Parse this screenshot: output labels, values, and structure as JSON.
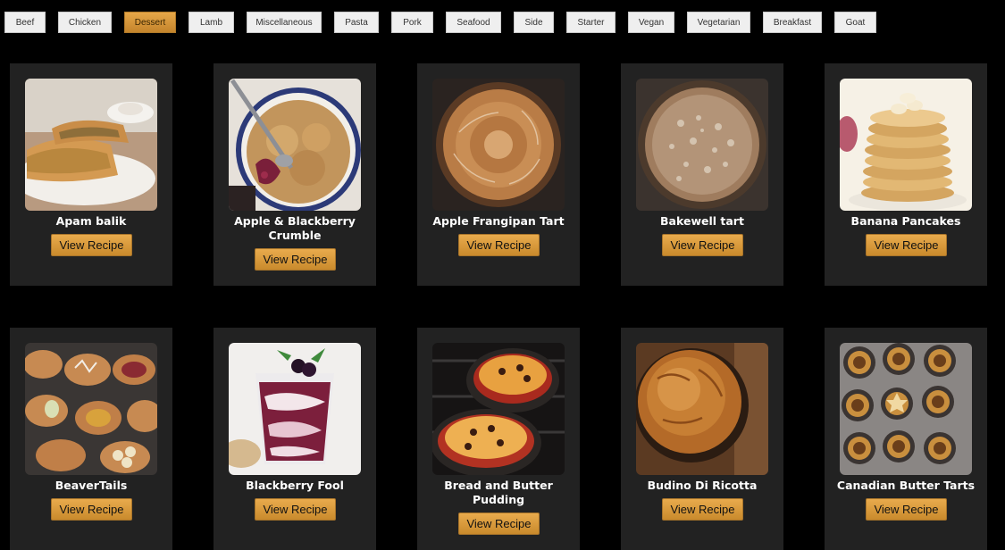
{
  "categories": [
    "Beef",
    "Chicken",
    "Dessert",
    "Lamb",
    "Miscellaneous",
    "Pasta",
    "Pork",
    "Seafood",
    "Side",
    "Starter",
    "Vegan",
    "Vegetarian",
    "Breakfast",
    "Goat"
  ],
  "active_category": "Dessert",
  "view_recipe_label": "View Recipe",
  "recipes": [
    {
      "name": "Apam balik"
    },
    {
      "name": "Apple & Blackberry Crumble"
    },
    {
      "name": "Apple Frangipan Tart"
    },
    {
      "name": "Bakewell tart"
    },
    {
      "name": "Banana Pancakes"
    },
    {
      "name": "BeaverTails"
    },
    {
      "name": "Blackberry Fool"
    },
    {
      "name": "Bread and Butter Pudding"
    },
    {
      "name": "Budino Di Ricotta"
    },
    {
      "name": "Canadian Butter Tarts"
    }
  ],
  "colors": {
    "background": "#000000",
    "card": "#222222",
    "accent": "#d89a3e",
    "tab": "#efefef"
  }
}
